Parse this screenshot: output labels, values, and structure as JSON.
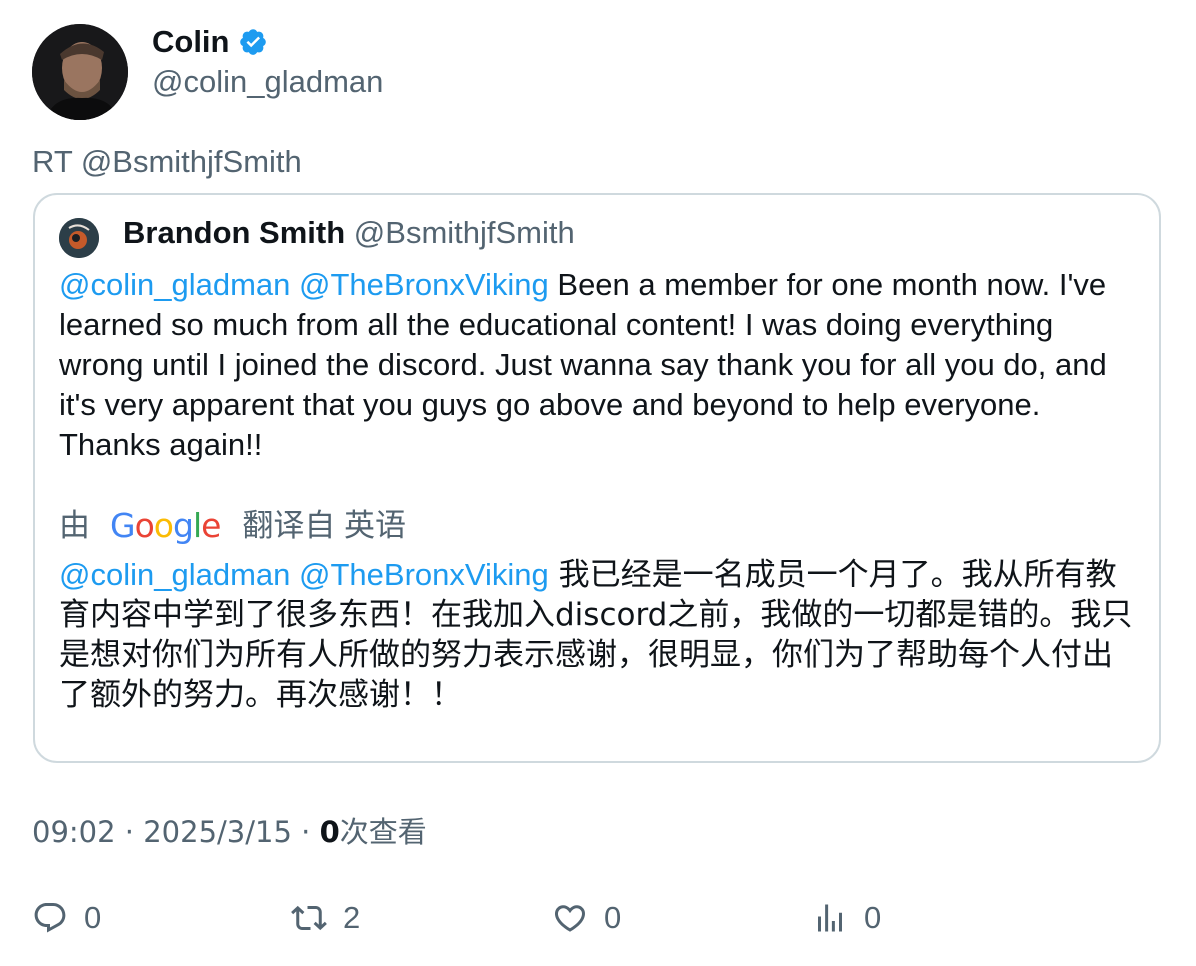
{
  "author": {
    "name": "Colin",
    "handle": "@colin_gladman",
    "verified": true
  },
  "retweet_label": "RT @BsmithjfSmith",
  "quoted": {
    "name": "Brandon Smith",
    "handle": "@BsmithjfSmith",
    "mention1": "@colin_gladman",
    "mention2": "@TheBronxViking",
    "text": "Been a member for one month now. I've learned so much from all the educational content! I was doing everything wrong until I joined the discord. Just wanna say thank you for all you do, and it's very apparent that you guys go above and beyond to help everyone. Thanks again!!",
    "translation": {
      "prefix": "由",
      "provider": "Google",
      "suffix": "翻译自 英语",
      "text": "我已经是一名成员一个月了。我从所有教育内容中学到了很多东西！在我加入discord之前，我做的一切都是错的。我只是想对你们为所有人所做的努力表示感谢，很明显，你们为了帮助每个人付出了额外的努力。再次感谢！！"
    }
  },
  "meta": {
    "time": "09:02",
    "date": "2025/3/15",
    "views_count": "0",
    "views_label": "次查看"
  },
  "actions": {
    "reply_count": "0",
    "retweet_count": "2",
    "like_count": "0",
    "views_count": "0"
  },
  "colors": {
    "accent": "#1d9bf0",
    "secondary_text": "#536471",
    "border": "#cfd9de"
  }
}
